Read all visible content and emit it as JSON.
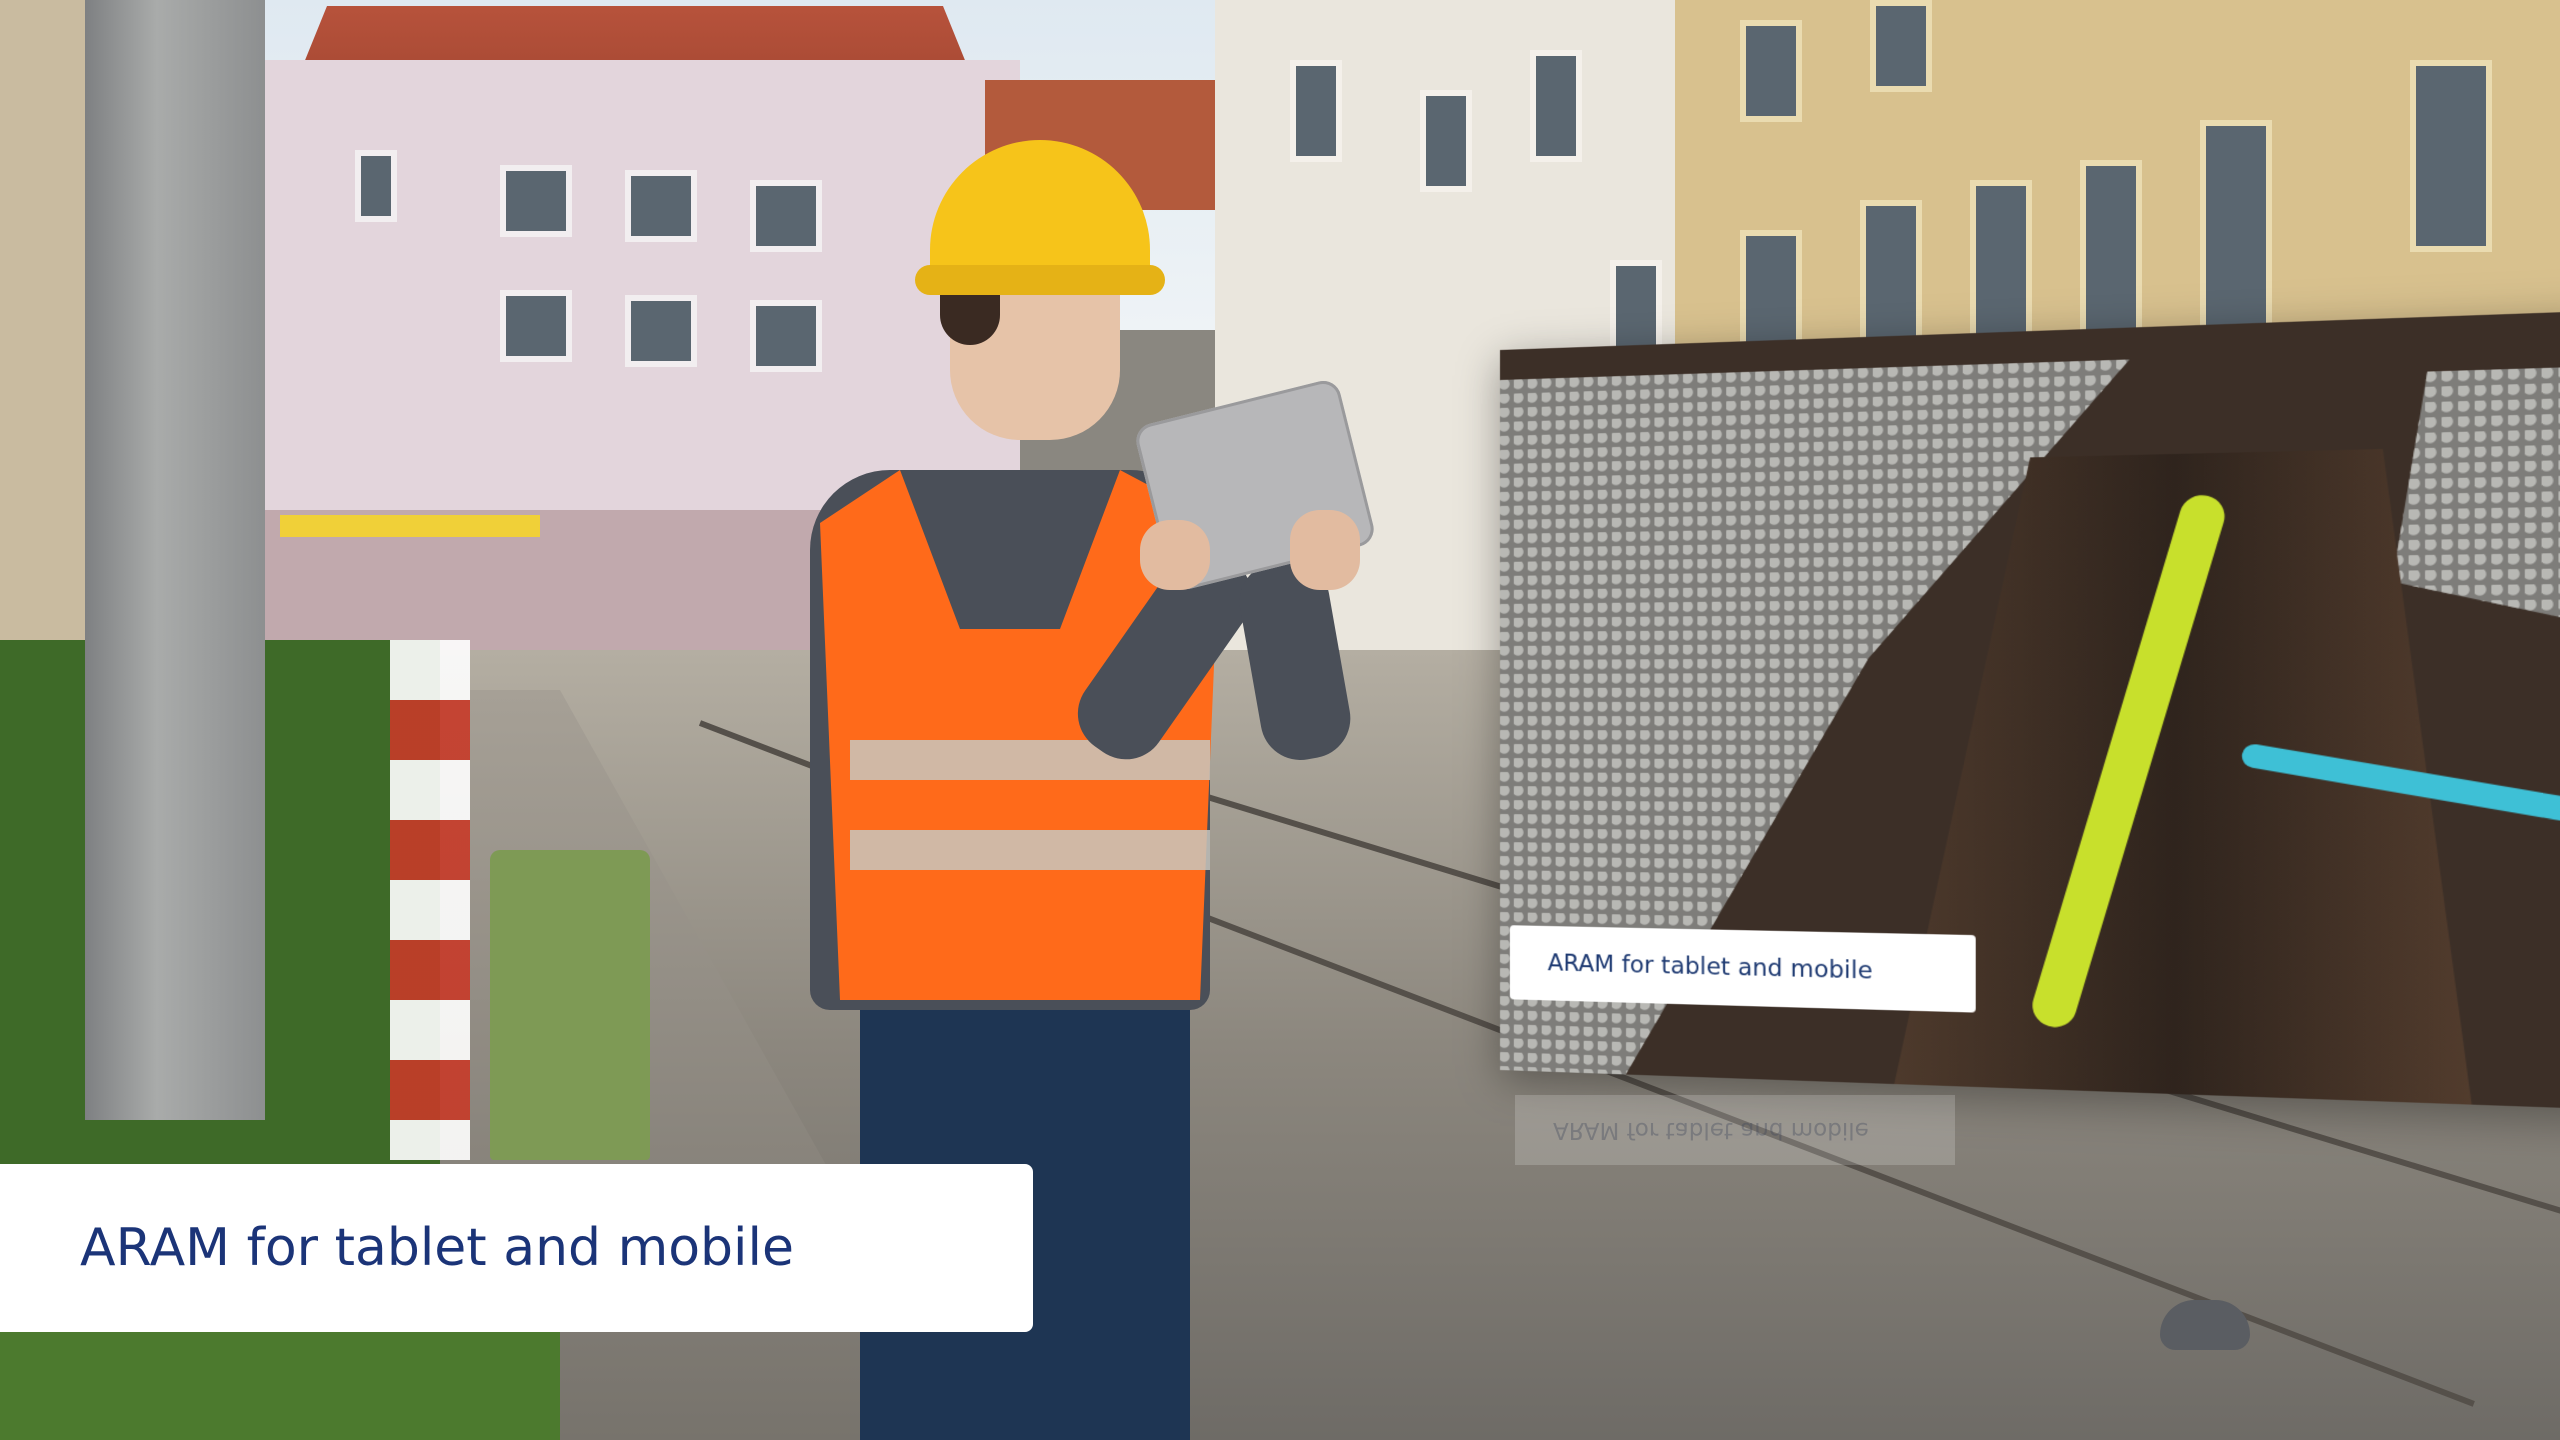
{
  "video": {
    "lower_third_caption": "ARAM for tablet and mobile",
    "ar_panel_caption": "ARAM for tablet and mobile",
    "ar_panel_reflection": "ARAM for tablet and mobile"
  },
  "colors": {
    "caption_text": "#1b3478",
    "caption_background": "#ffffff",
    "vest": "#ff6a1a",
    "helmet": "#f6c41a",
    "ar_pipe_yellow": "#c8e02c",
    "ar_pipe_cyan": "#3ec0d6"
  }
}
